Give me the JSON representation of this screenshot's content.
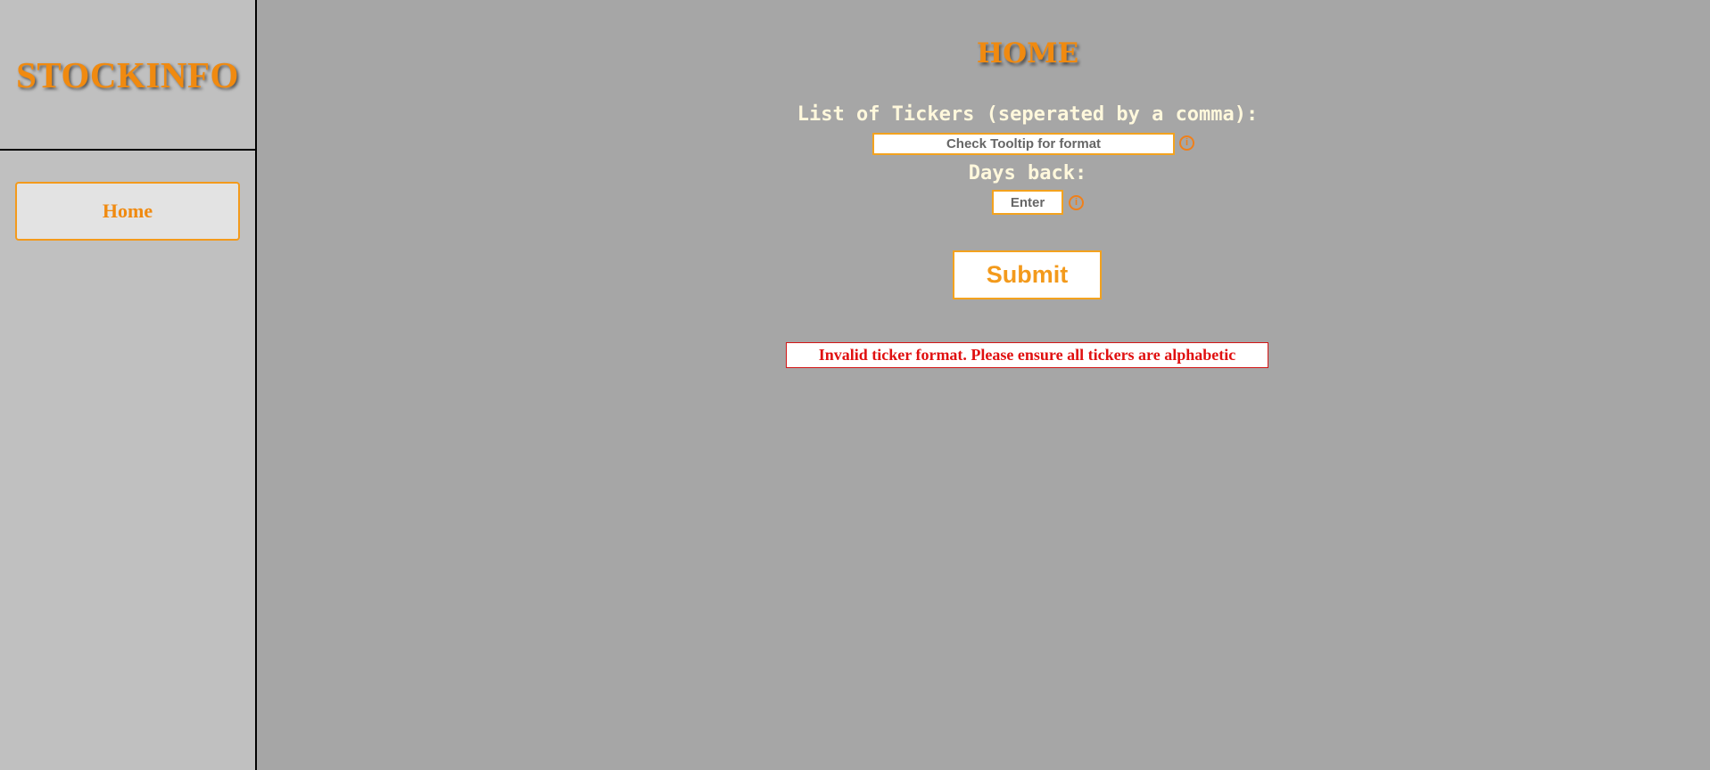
{
  "sidebar": {
    "brand_title": "STOCKINFO",
    "nav_items": [
      {
        "label": "Home"
      }
    ]
  },
  "main": {
    "page_title": "HOME",
    "tickers": {
      "label": "List of Tickers (seperated by a comma):",
      "placeholder": "Check Tooltip for format",
      "info_icon_glyph": "i"
    },
    "days_back": {
      "label": "Days back:",
      "placeholder": "Enter",
      "info_icon_glyph": "i"
    },
    "submit_label": "Submit",
    "error_message": "Invalid ticker format. Please ensure all tickers are alphabetic"
  },
  "colors": {
    "accent": "#f08a10",
    "error": "#e01010",
    "sidebar_bg": "#c0c0c0",
    "main_bg": "#a6a6a6",
    "label_text": "#fff8dc"
  },
  "icons": {
    "tickers_info": "info-circle-icon",
    "days_info": "info-circle-icon"
  }
}
